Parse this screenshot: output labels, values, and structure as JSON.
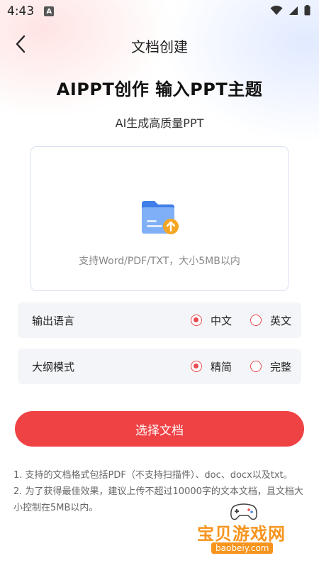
{
  "status_bar": {
    "time": "4:43",
    "notification_badge": "A"
  },
  "nav": {
    "title": "文档创建"
  },
  "headline": "AIPPT创作  输入PPT主题",
  "subtitle": "AI生成高质量PPT",
  "upload": {
    "hint": "支持Word/PDF/TXT，大小5MB以内",
    "icon": "folder-upload-icon"
  },
  "output_language": {
    "label": "输出语言",
    "options": [
      {
        "label": "中文",
        "selected": true
      },
      {
        "label": "英文",
        "selected": false
      }
    ]
  },
  "outline_mode": {
    "label": "大纲模式",
    "options": [
      {
        "label": "精简",
        "selected": true
      },
      {
        "label": "完整",
        "selected": false
      }
    ]
  },
  "choose_button": "选择文档",
  "notes": [
    "1. 支持的文档格式包括PDF（不支持扫描件）、doc、docx以及txt。",
    "2. 为了获得最佳效果，建议上传不超过10000字的文本文档，且文档大小控制在5MB以内。"
  ],
  "watermark": {
    "text": "宝贝游戏网",
    "url": "baobeiy.com"
  },
  "colors": {
    "accent": "#ef4245",
    "option_bg": "#f4f5f8",
    "folder_blue": "#4a86f0",
    "upload_badge": "#f5a623"
  }
}
